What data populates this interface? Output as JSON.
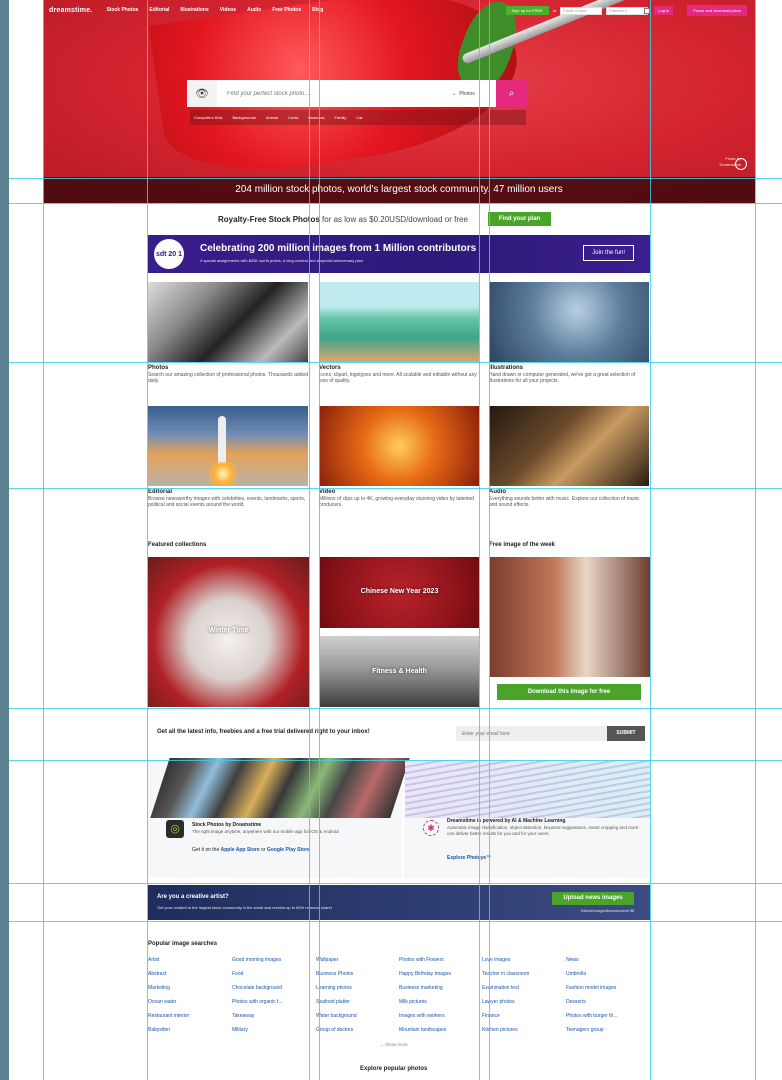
{
  "header": {
    "logo": "dreamstime.",
    "nav": [
      "Stock Photos",
      "Editorial",
      "Illustrations",
      "Videos",
      "Audio",
      "Free Photos",
      "Blog"
    ],
    "signup": "Sign up for FREE",
    "or": "or",
    "email_placeholder": "Email or user",
    "password_placeholder": "Password",
    "login": "Log in",
    "prices": "Prices and download plans"
  },
  "hero": {
    "search_placeholder": "Find your perfect stock photo...",
    "search_type": "Photos",
    "tags": [
      "Computers Kids",
      "Backgrounds",
      "Animal",
      "Covid",
      "Business",
      "Family",
      "Car"
    ],
    "caption": "204 million stock photos, world's largest stock community. 47 million users",
    "credit_line1": "Photo by",
    "credit_line2": "Dreamstime"
  },
  "promo": {
    "bold": "Royalty-Free Stock Photos",
    "rest": " for as low as $0.20USD/download or free",
    "button": "Find your plan"
  },
  "anniversary": {
    "logo": "sdt 20 1",
    "title": "Celebrating 200 million images from 1 Million contributors",
    "subtitle": "4 special assignments with $20K worth prizes, a blog contest and a special anniversary plan",
    "button": "Join the fun!"
  },
  "categories": [
    {
      "title": "Photos",
      "desc": "Search our amazing collection of professional photos. Thousands added daily."
    },
    {
      "title": "Vectors",
      "desc": "Icons, clipart, logotypes and more. All scalable and editable without any loss of quality."
    },
    {
      "title": "Illustrations",
      "desc": "Hand drawn or computer generated, we've got a great selection of illustrations for all your projects."
    },
    {
      "title": "Editorial",
      "desc": "Browse newsworthy images with celebrities, events, landmarks, sports, political and social events around the world."
    },
    {
      "title": "Video",
      "desc": "Millions of clips up to 4K, growing everyday stunning video by talented producers."
    },
    {
      "title": "Audio",
      "desc": "Everything sounds better with music. Explore our collection of music and sound effects."
    }
  ],
  "featured": {
    "heading": "Featured collections",
    "winter": "Winter Time",
    "cny": "Chinese New Year 2023",
    "fitness": "Fitness & Health",
    "free_heading": "Free image of the week",
    "download": "Download this image for free"
  },
  "newsletter": {
    "text": "Get all the latest info, freebies and a free trial delivered right to your inbox!",
    "placeholder": "Enter your email here",
    "submit": "SUBMIT"
  },
  "apps": {
    "stock_title": "Stock Photos by Dreamstime",
    "stock_desc": "The right image anytime, anywhere with our mobile app for iOS & Android",
    "get_prefix": "Get it on the ",
    "apple": "Apple App Store",
    "or": " or ",
    "google": "Google Play Store",
    "ai_title": "Dreamstime is powered by AI & Machine Learning",
    "ai_desc": "Automatic image classification, object detection, keyword suggestions, smart cropping and more can deliver better results for you and for your users.",
    "ai_link": "Explore Photeye™"
  },
  "creative": {
    "title": "Are you a creative artist?",
    "subtitle": "Get your content to the largest stock community in the world and receive up to 60% revenue share!",
    "button": "Upload news images",
    "small": "Editorial images/license/course $$"
  },
  "popular": {
    "title": "Popular image searches",
    "columns": [
      [
        "Artist",
        "Abstract",
        "Marketing",
        "Ocean water",
        "Restaurant interior",
        "Babysitter"
      ],
      [
        "Good morning images",
        "Food",
        "Chocolate background",
        "Photos with organic f...",
        "Takeaway",
        "Military"
      ],
      [
        "Wallpaper",
        "Business Photos",
        "Learning photos",
        "Seafood platter",
        "Water background",
        "Group of doctors"
      ],
      [
        "Photos with Flowers",
        "Happy Birthday Images",
        "Business marketing",
        "Milk pictures",
        "Images with workers",
        "Mountain landscapes"
      ],
      [
        "Love images",
        "Teacher in classroom",
        "Examination test",
        "Lawyer photos",
        "Finance",
        "Kitchen pictures"
      ],
      [
        "News",
        "Umbrella",
        "Fashion model images",
        "Desserts",
        "Photos with burger th...",
        "Teenagers group"
      ]
    ],
    "show_more": "⌄ Show more",
    "explore": "Explore popular photos"
  }
}
